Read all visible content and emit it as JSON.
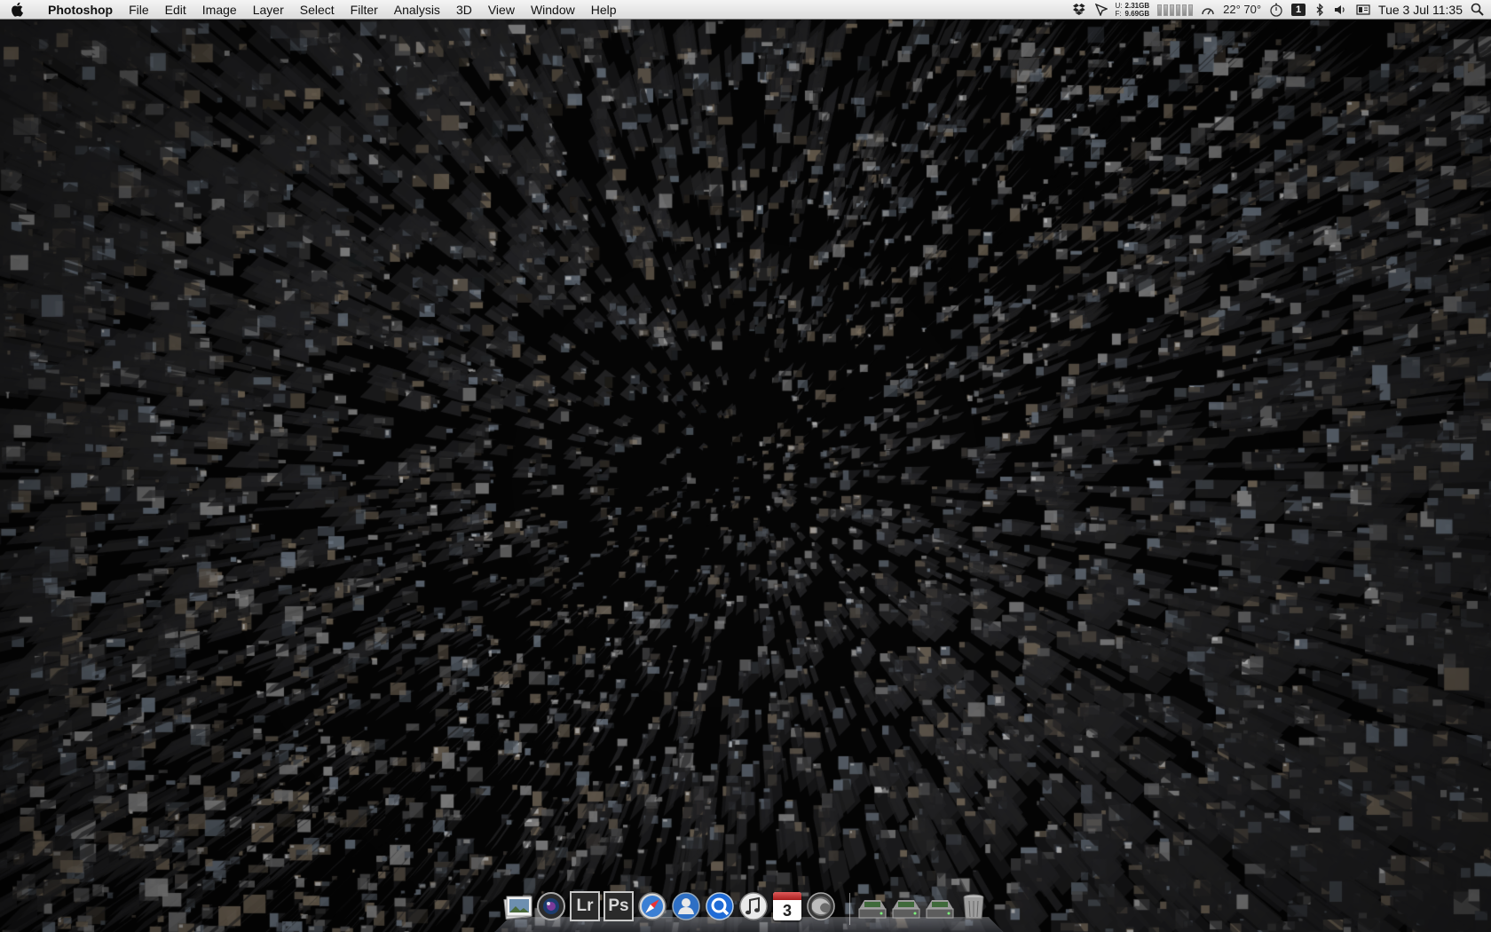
{
  "menubar": {
    "app_name": "Photoshop",
    "menus": [
      "File",
      "Edit",
      "Image",
      "Layer",
      "Select",
      "Filter",
      "Analysis",
      "3D",
      "View",
      "Window",
      "Help"
    ],
    "status": {
      "memory_labels": [
        "U:",
        "F:"
      ],
      "memory_values": [
        "2.31GB",
        "9.69GB"
      ],
      "temperatures": "22° 70°",
      "space_number": "1",
      "clock": "Tue 3 Jul  11:35"
    }
  },
  "dock": {
    "items": [
      {
        "name": "preview-app",
        "icon": "photo-stack-icon"
      },
      {
        "name": "photo-booth-app",
        "icon": "camera-lens-icon"
      },
      {
        "name": "lightroom-app",
        "icon": "lightroom-icon",
        "label": "Lr"
      },
      {
        "name": "photoshop-app",
        "icon": "photoshop-icon",
        "label": "Ps"
      },
      {
        "name": "safari-app",
        "icon": "compass-icon"
      },
      {
        "name": "contacts-app",
        "icon": "person-icon"
      },
      {
        "name": "quicktime-app",
        "icon": "quicktime-icon"
      },
      {
        "name": "itunes-app",
        "icon": "music-note-icon"
      },
      {
        "name": "ical-app",
        "icon": "calendar-icon",
        "day": "3"
      },
      {
        "name": "firefox-app",
        "icon": "globe-icon"
      },
      {
        "name": "drive-stack-1",
        "icon": "hard-drive-icon"
      },
      {
        "name": "drive-stack-2",
        "icon": "hard-drive-icon"
      },
      {
        "name": "drive-stack-3",
        "icon": "hard-drive-icon"
      },
      {
        "name": "trash",
        "icon": "trash-icon"
      }
    ]
  },
  "colors": {
    "wallpaper_base": "#050505",
    "building_light": "#b8b8b8",
    "building_warm": "#9a8a74",
    "building_cool": "#8a98a8"
  }
}
